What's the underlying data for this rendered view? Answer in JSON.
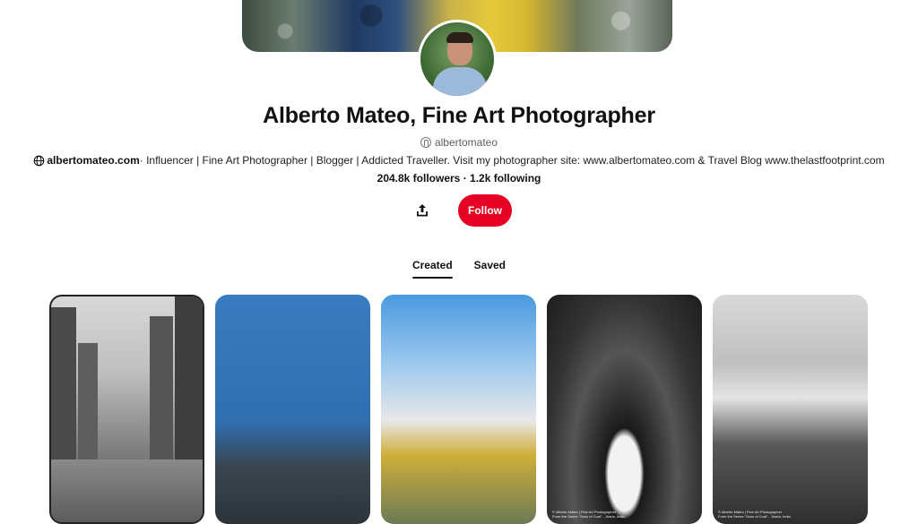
{
  "profile": {
    "name": "Alberto Mateo, Fine Art Photographer",
    "username": "albertomateo",
    "website": "albertomateo.com",
    "bio": " · Influencer | Fine Art Photographer | Blogger | Addicted Traveller. Visit my photographer site: www.albertomateo.com & Travel Blog www.thelastfootprint.com",
    "stats": "204.8k followers · 1.2k following"
  },
  "actions": {
    "share_icon": "share-icon",
    "follow_label": "Follow",
    "follow_color": "#e60023"
  },
  "tabs": [
    {
      "label": "Created",
      "active": true
    },
    {
      "label": "Saved",
      "active": false
    }
  ],
  "pins": [
    {
      "caption_line1": "",
      "caption_line2": ""
    },
    {
      "caption_line1": "",
      "caption_line2": ""
    },
    {
      "caption_line1": "",
      "caption_line2": ""
    },
    {
      "caption_line1": "© Alberto Mateo | Fine Art Photographer",
      "caption_line2": "From the Series \"Sons of Coal\" - Jharia, India."
    },
    {
      "caption_line1": "© Alberto Mateo | Fine Art Photographer",
      "caption_line2": "From the Series \"Sons of Coal\" - Jharia, India."
    }
  ]
}
